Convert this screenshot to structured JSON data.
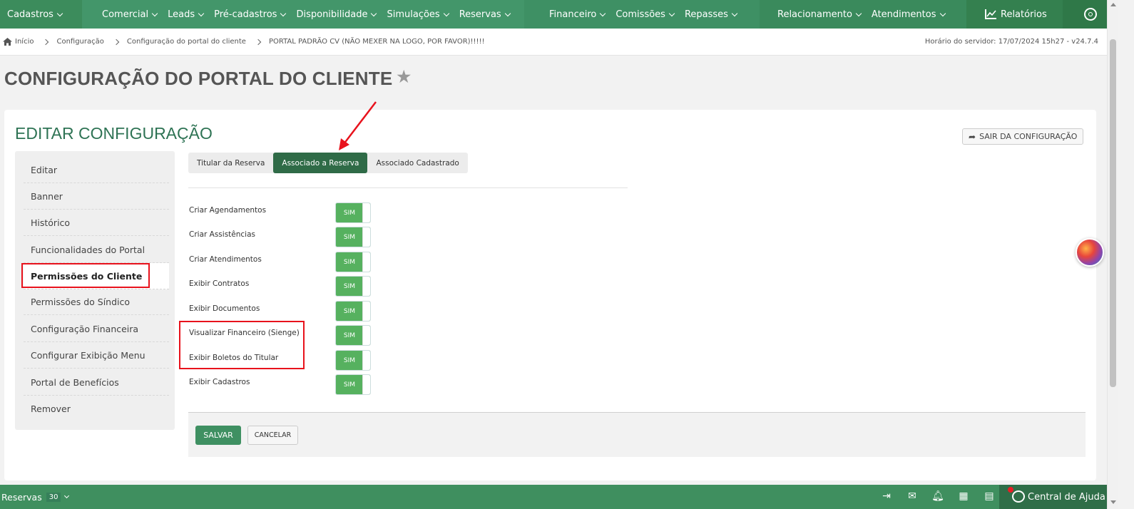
{
  "topnav": {
    "items": [
      {
        "label": "Cadastros"
      },
      {
        "label": "Comercial"
      },
      {
        "label": "Leads"
      },
      {
        "label": "Pré-cadastros"
      },
      {
        "label": "Disponibilidade"
      },
      {
        "label": "Simulações"
      },
      {
        "label": "Reservas"
      },
      {
        "label": "Financeiro"
      },
      {
        "label": "Comissões"
      },
      {
        "label": "Repasses"
      },
      {
        "label": "Relacionamento"
      },
      {
        "label": "Atendimentos"
      }
    ],
    "reports_label": "Relatórios"
  },
  "breadcrumb": {
    "items": [
      "Início",
      "Configuração",
      "Configuração do portal do cliente",
      "PORTAL PADRÃO CV (NÃO MEXER NA LOGO, POR FAVOR)!!!!!"
    ],
    "server_time": "Horário do servidor: 17/07/2024 15h27 - v24.7.4"
  },
  "page": {
    "title": "CONFIGURAÇÃO DO PORTAL DO CLIENTE"
  },
  "card": {
    "title": "EDITAR CONFIGURAÇÃO",
    "exit_label": "SAIR DA CONFIGURAÇÃO"
  },
  "sidebar": {
    "items": [
      {
        "label": "Editar"
      },
      {
        "label": "Banner"
      },
      {
        "label": "Histórico"
      },
      {
        "label": "Funcionalidades do Portal"
      },
      {
        "label": "Permissões do Cliente"
      },
      {
        "label": "Permissões do Síndico"
      },
      {
        "label": "Configuração Financeira"
      },
      {
        "label": "Configurar Exibição Menu"
      },
      {
        "label": "Portal de Benefícios"
      },
      {
        "label": "Remover"
      }
    ],
    "active_index": 4
  },
  "tabs": {
    "items": [
      {
        "label": "Titular da Reserva"
      },
      {
        "label": "Associado a Reserva"
      },
      {
        "label": "Associado Cadastrado"
      }
    ],
    "active_index": 1
  },
  "permissions": {
    "items": [
      {
        "label": "Criar Agendamentos",
        "value": "SIM"
      },
      {
        "label": "Criar Assistências",
        "value": "SIM"
      },
      {
        "label": "Criar Atendimentos",
        "value": "SIM"
      },
      {
        "label": "Exibir Contratos",
        "value": "SIM"
      },
      {
        "label": "Exibir Documentos",
        "value": "SIM"
      },
      {
        "label": "Visualizar Financeiro (Sienge)",
        "value": "SIM"
      },
      {
        "label": "Exibir Boletos do Titular",
        "value": "SIM"
      },
      {
        "label": "Exibir Cadastros",
        "value": "SIM"
      }
    ]
  },
  "actions": {
    "save_label": "SALVAR",
    "cancel_label": "CANCELAR"
  },
  "bottombar": {
    "reservas_label": "Reservas",
    "reservas_count": "30",
    "help_label": "Central de Ajuda"
  },
  "colors": {
    "nav_green": "#3e8f5f",
    "accent_dark_green": "#2f6b47",
    "toggle_green": "#56b15f",
    "annotation_red": "#e8121c"
  }
}
